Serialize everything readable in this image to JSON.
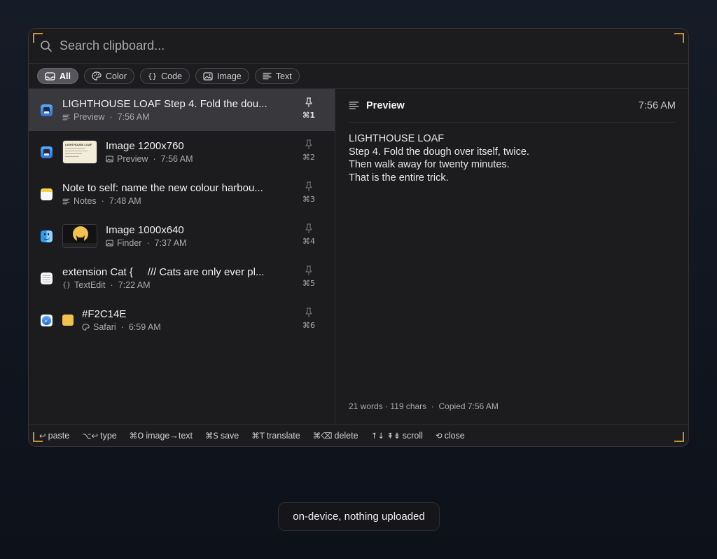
{
  "search": {
    "placeholder": "Search clipboard..."
  },
  "filters": [
    {
      "label": "All",
      "icon": "tray-icon",
      "active": true
    },
    {
      "label": "Color",
      "icon": "palette-icon",
      "active": false
    },
    {
      "label": "Code",
      "icon": "braces-icon",
      "active": false
    },
    {
      "label": "Image",
      "icon": "photo-icon",
      "active": false
    },
    {
      "label": "Text",
      "icon": "lines-icon",
      "active": false
    }
  ],
  "items": [
    {
      "title": "LIGHTHOUSE LOAF Step 4. Fold the dou...",
      "kind_icon": "lines-icon",
      "app": "Preview",
      "time": "7:56 AM",
      "shortcut": "⌘1",
      "selected": true
    },
    {
      "title": "Image 1200x760",
      "kind_icon": "photo-icon",
      "app": "Preview",
      "time": "7:56 AM",
      "shortcut": "⌘2",
      "thumb_text": "LIGHTHOUSE LOAF"
    },
    {
      "title": "Note to self: name the new colour harbou...",
      "kind_icon": "lines-icon",
      "app": "Notes",
      "time": "7:48 AM",
      "shortcut": "⌘3"
    },
    {
      "title": "Image 1000x640",
      "kind_icon": "photo-icon",
      "app": "Finder",
      "time": "7:37 AM",
      "shortcut": "⌘4"
    },
    {
      "title": "extension Cat {     /// Cats are only ever pl...",
      "kind_icon": "braces-icon",
      "app": "TextEdit",
      "time": "7:22 AM",
      "shortcut": "⌘5"
    },
    {
      "title": "#F2C14E",
      "kind_icon": "palette-icon",
      "app": "Safari",
      "time": "6:59 AM",
      "shortcut": "⌘6",
      "swatch": "#F2C14E"
    }
  ],
  "preview": {
    "title": "Preview",
    "time": "7:56 AM",
    "lines": [
      "LIGHTHOUSE LOAF",
      "Step 4. Fold the dough over itself, twice.",
      "Then walk away for twenty minutes.",
      "That is the entire trick."
    ],
    "footer": "21 words · 119 chars  ·  Copied 7:56 AM"
  },
  "hints": [
    {
      "keys": "↩",
      "label": "paste"
    },
    {
      "keys": "⌥↩",
      "label": "type"
    },
    {
      "keys": "⌘O",
      "label": "image→text"
    },
    {
      "keys": "⌘S",
      "label": "save"
    },
    {
      "keys": "⌘T",
      "label": "translate"
    },
    {
      "keys": "⌘⌫",
      "label": "delete"
    },
    {
      "keys": "↑↓ ⇞⇟",
      "label": "scroll"
    },
    {
      "keys": "⟲",
      "label": "close"
    }
  ],
  "toast": "on-device, nothing uploaded",
  "colors": {
    "accent_corner": "#c8932f",
    "panel_bg": "#1c1c1e",
    "selected_row": "#39393d"
  }
}
